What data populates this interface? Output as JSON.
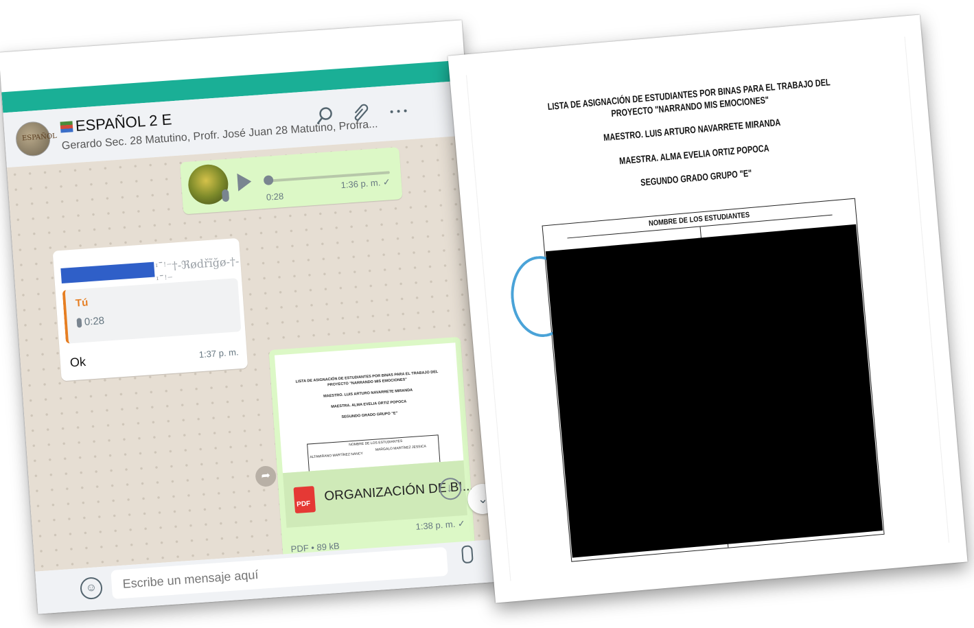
{
  "chat": {
    "group_name": "ESPAÑOL 2 E",
    "avatar_text": "ESPAÑOL",
    "participants": "Gerardo Sec. 28 Matutino, Profr. José Juan 28 Matutino, Profra...",
    "audio_message": {
      "duration": "0:28",
      "time": "1:36 p. m. ✓"
    },
    "reply_message": {
      "sender": "ᶦ¯ꜝ⁻†-ℜødřĩğø-†-ᶦ¯ꜝ⁻",
      "quote_author": "Tú",
      "quote_audio": "0:28",
      "text": "Ok",
      "time": "1:37 p. m."
    },
    "document_message": {
      "preview_lines": [
        "LISTA DE ASIGNACIÓN DE ESTUDIANTES POR BINAS PARA EL TRABAJO DEL",
        "PROYECTO \"NARRANDO MIS EMOCIONES\"",
        "MAESTRO. LUIS ARTURO NAVARRETE MIRANDA",
        "MAESTRA. ALMA EVELIA ORTIZ POPOCA",
        "SEGUNDO GRADO GRUPO \"E\""
      ],
      "preview_table_head": "NOMBRE DE LOS ESTUDIANTES",
      "preview_row_left": "ALTAMIRANO MARTÍNEZ NANCY",
      "preview_row_right": "MARGALO MARTÍNEZ JESSICA",
      "pdf_label": "PDF",
      "file_name": "ORGANIZACIÓN DE BI...",
      "time": "1:38 p. m. ✓",
      "meta": "PDF • 89 kB"
    },
    "input_placeholder": "Escribe un mensaje aquí"
  },
  "document": {
    "title_line1": "LISTA DE ASIGNACIÓN DE ESTUDIANTES POR BINAS PARA EL TRABAJO DEL",
    "title_line2": "PROYECTO \"NARRANDO MIS EMOCIONES\"",
    "teacher1": "MAESTRO. LUIS ARTURO NAVARRETE MIRANDA",
    "teacher2": "MAESTRA. ALMA EVELIA ORTIZ POPOCA",
    "grade": "SEGUNDO GRADO GRUPO \"E\"",
    "table_header": "NOMBRE DE LOS ESTUDIANTES"
  },
  "colors": {
    "accent": "#1aaf96",
    "outgoing_bubble": "#dcf8c6",
    "incoming_bubble": "#ffffff",
    "chat_background": "#e6ded3",
    "pdf_red": "#e53935",
    "redaction": "#000000"
  }
}
